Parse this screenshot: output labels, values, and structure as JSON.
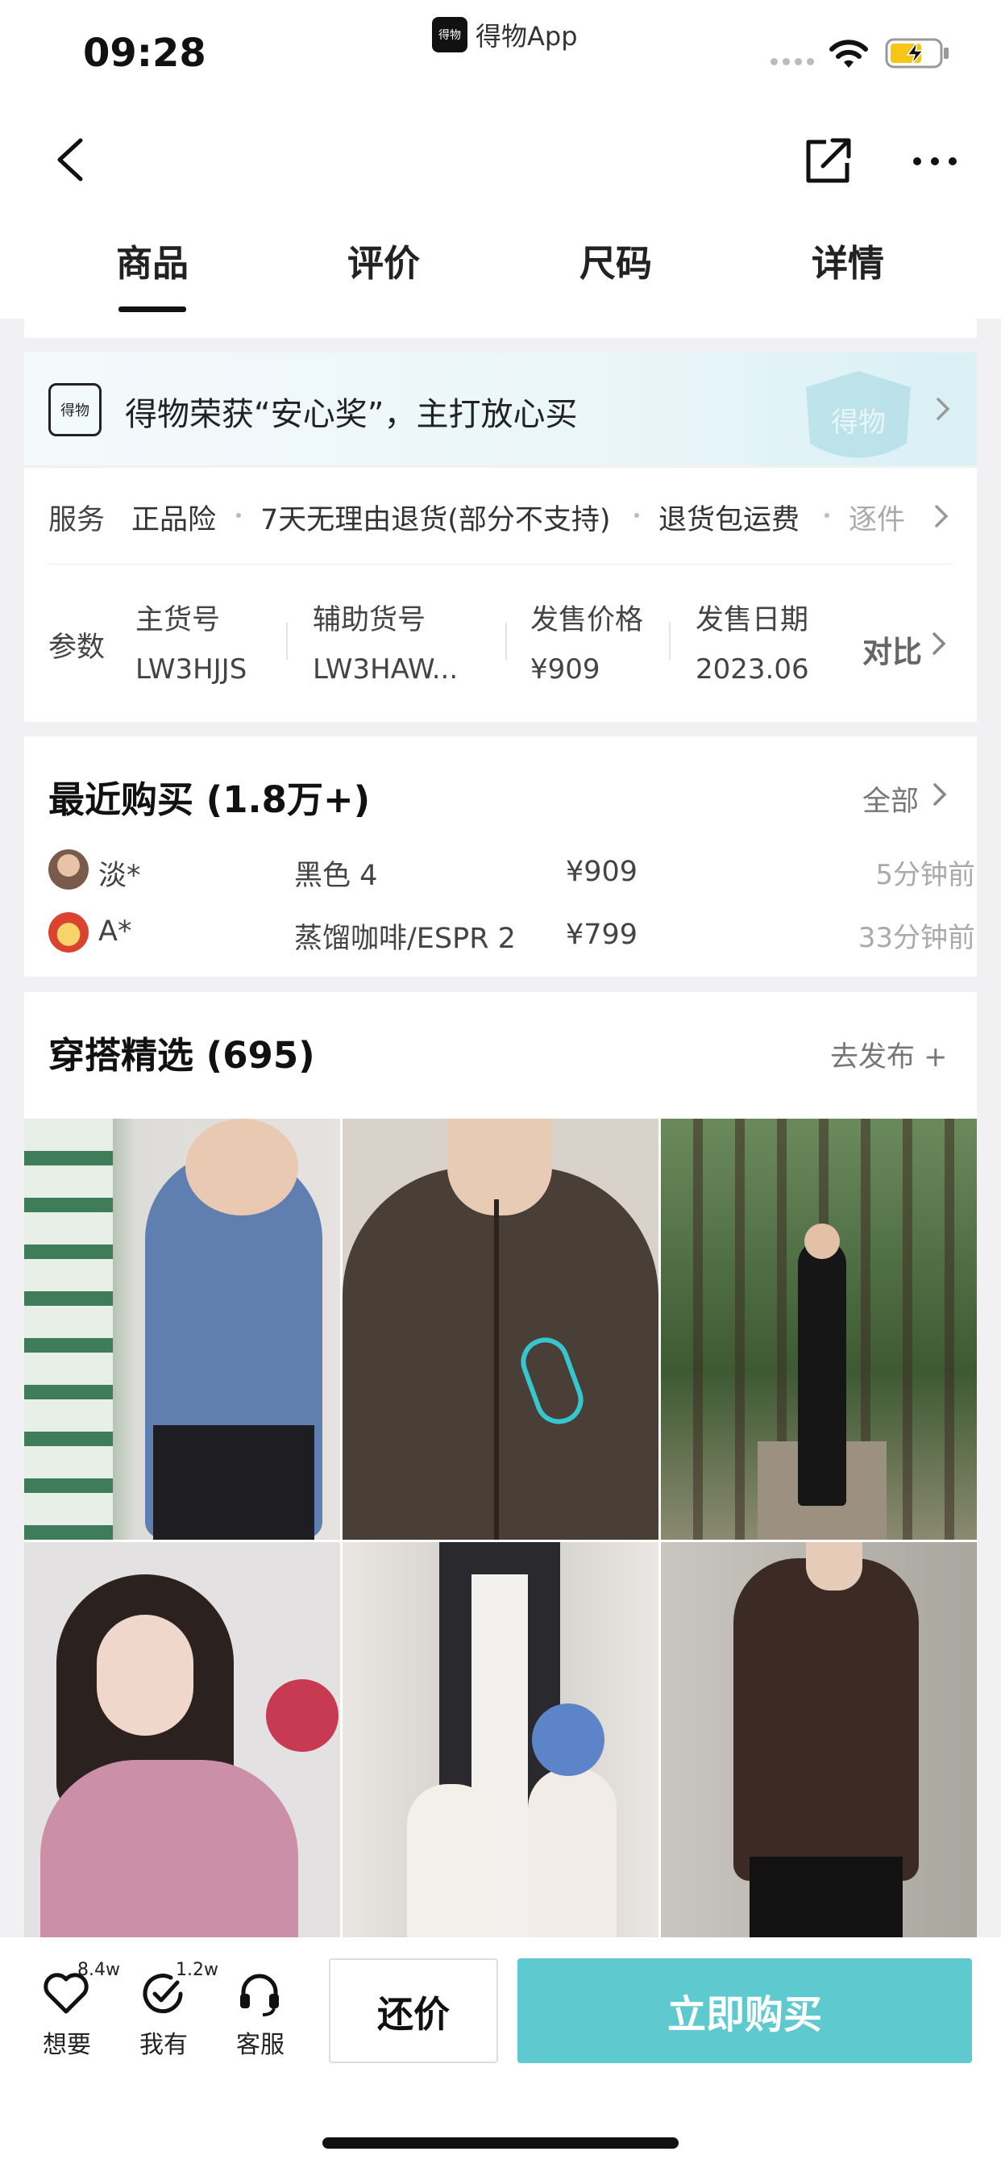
{
  "status_bar": {
    "time": "09:28",
    "app_name": "得物App",
    "app_logo_text": "得物"
  },
  "tabs": [
    "商品",
    "评价",
    "尺码",
    "详情"
  ],
  "award": {
    "logo_text": "得物",
    "text": "得物荣获“安心奖”，主打放心买",
    "shield_text": "得物"
  },
  "service": {
    "label": "服务",
    "items": [
      "正品险",
      "7天无理由退货(部分不支持)",
      "退货包运费",
      "逐件"
    ]
  },
  "params": {
    "label": "参数",
    "columns": [
      {
        "head": "主货号",
        "value": "LW3HJJS"
      },
      {
        "head": "辅助货号",
        "value": "LW3HAW..."
      },
      {
        "head": "发售价格",
        "value": "¥909"
      },
      {
        "head": "发售日期",
        "value": "2023.06"
      }
    ],
    "compare": "对比"
  },
  "recent": {
    "title": "最近购买 (1.8万+)",
    "all_link": "全部",
    "rows": [
      {
        "name": "淡*",
        "spec": "黑色 4",
        "price": "¥909",
        "time": "5分钟前"
      },
      {
        "name": "A*",
        "spec": "蒸馏咖啡/ESPR 2",
        "price": "¥799",
        "time": "33分钟前"
      }
    ]
  },
  "outfit": {
    "title": "穿搭精选 (695)",
    "publish_link": "去发布 +"
  },
  "bottom": {
    "want": {
      "label": "想要",
      "count": "8.4w"
    },
    "have": {
      "label": "我有",
      "count": "1.2w"
    },
    "service": {
      "label": "客服"
    },
    "bargain": "还价",
    "buy_now": "立即购买"
  },
  "colors": {
    "accent": "#5ecad0",
    "background": "#f1f1f3"
  }
}
